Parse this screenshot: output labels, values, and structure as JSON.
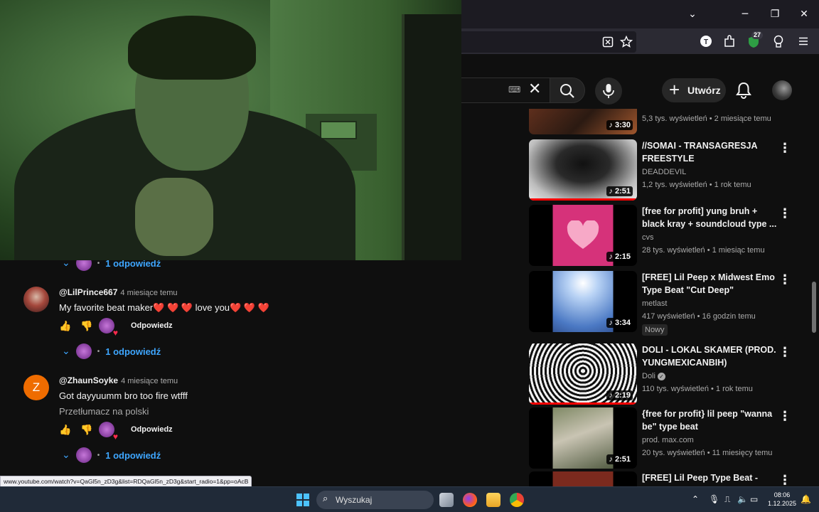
{
  "browser": {
    "window_controls": {
      "list": "⌄",
      "minimize": "─",
      "maximize": "❐",
      "close": "✕"
    },
    "extensions_badge": "27"
  },
  "youtube_header": {
    "keyboard_icon": "⌨",
    "clear": "✕",
    "create_label": "Utwórz"
  },
  "comments": [
    {
      "author": "@LilPrince667",
      "time": "4 miesiące temu",
      "text": "My favorite beat maker❤️ ❤️ ❤️ love you❤️ ❤️ ❤️",
      "reply_label": "Odpowiedz"
    },
    {
      "author": "@ZhaunSoyke",
      "time": "4 miesiące temu",
      "avatar_letter": "Z",
      "text": "Got dayyuumm bro too fire wtfff",
      "translate": "Przetłumacz na polski",
      "reply_label": "Odpowiedz"
    }
  ],
  "replies_label": "1 odpowiedź",
  "status_url": "www.youtube.com/watch?v=QaGl5n_zD3g&list=RDQaGl5n_zD3g&start_radio=1&pp=oAcB",
  "sidebar": {
    "top_partial": {
      "meta": "5,3 tys. wyświetleń • 2 miesiące temu",
      "duration": "3:30"
    },
    "videos": [
      {
        "title": "//SOMAI - TRANSAGRESJA FREESTYLE",
        "channel": "DEADDEVIL",
        "meta": "1,2 tys. wyświetleń • 1 rok temu",
        "duration": "2:51"
      },
      {
        "title": "[free for profit] yung bruh + black kray + soundcloud type ...",
        "channel": "cvs",
        "meta": "28 tys. wyświetleń • 1 miesiąc temu",
        "duration": "2:15"
      },
      {
        "title": "[FREE] Lil Peep x Midwest Emo Type Beat \"Cut Deep\"",
        "channel": "metlast",
        "meta": "417 wyświetleń • 16 godzin temu",
        "duration": "3:34",
        "badge": "Nowy"
      },
      {
        "title": "DOLI - LOKAL SKAMER (PROD. YUNGMEXICANBIH)",
        "channel": "Doli",
        "meta": "110 tys. wyświetleń • 1 rok temu",
        "duration": "2:19"
      },
      {
        "title": "{free for profit} lil peep \"wanna be\" type beat",
        "channel": "prod. max.com",
        "meta": "20 tys. wyświetleń • 11 miesięcy temu",
        "duration": "2:51"
      },
      {
        "title": "[FREE] Lil Peep Type Beat - \"She"
      }
    ]
  },
  "taskbar": {
    "search_label": "Wyszukaj",
    "time": "08:06",
    "date": "1.12.2025"
  },
  "colors": {
    "accent_blue": "#3ea6ff",
    "progress_red": "#ff0000",
    "avatar_orange": "#ef6c00"
  }
}
